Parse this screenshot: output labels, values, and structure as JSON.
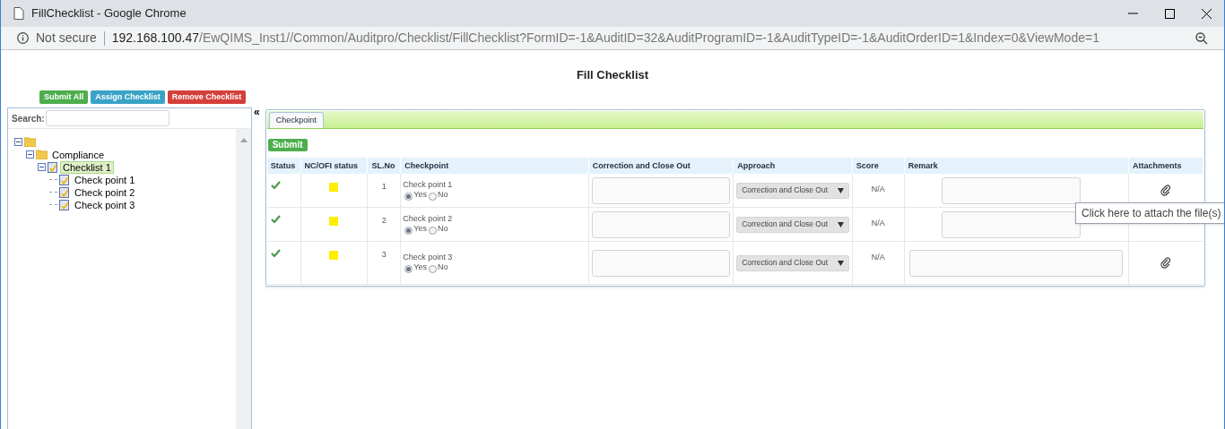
{
  "window": {
    "title": "FillChecklist - Google Chrome"
  },
  "address_bar": {
    "security": "Not secure",
    "host": "192.168.100.47",
    "path": "/EwQIMS_Inst1//Common/Auditpro/Checklist/FillChecklist?FormID=-1&AuditID=32&AuditProgramID=-1&AuditTypeID=-1&AuditOrderID=1&Index=0&ViewMode=1"
  },
  "page_title": "Fill Checklist",
  "actions": [
    {
      "label": "Submit All",
      "kind": "success"
    },
    {
      "label": "Assign Checklist",
      "kind": "info"
    },
    {
      "label": "Remove Checklist",
      "kind": "danger"
    }
  ],
  "sidebar": {
    "search_label": "Search:",
    "collapse": "«",
    "tree": [
      {
        "kind": "folder",
        "expanded": true,
        "children": [
          {
            "label": "Compliance",
            "kind": "folder",
            "expanded": true,
            "selected": false,
            "children": [
              {
                "label": "Checklist 1",
                "kind": "checklist",
                "expanded": true,
                "selected": true,
                "children": [
                  {
                    "label": "Check point 1",
                    "kind": "checklist",
                    "selected": false
                  },
                  {
                    "label": "Check point 2",
                    "kind": "checklist",
                    "selected": false
                  },
                  {
                    "label": "Check point 3",
                    "kind": "checklist",
                    "selected": false
                  }
                ]
              }
            ]
          }
        ]
      }
    ]
  },
  "tabs": [
    {
      "label": "Checkpoint",
      "selected": true
    }
  ],
  "submit": "Submit",
  "table": {
    "columns": [
      "Status",
      "NC/OFI status",
      "SL.No",
      "Checkpoint",
      "Correction and Close Out",
      "Approach",
      "Score",
      "Remark",
      "Attachments"
    ],
    "rows": [
      {
        "done": true,
        "color": "#ffee00",
        "sl": "1",
        "checkpoint": "Check point 1",
        "options": [
          {
            "label": "Yes",
            "selected": true
          },
          {
            "label": "No",
            "selected": false
          }
        ],
        "approach": "Correction and Close Out",
        "score": "N/A",
        "attachment": true
      },
      {
        "done": true,
        "color": "#ffee00",
        "sl": "2",
        "checkpoint": "Check point 2",
        "options": [
          {
            "label": "Yes",
            "selected": true
          },
          {
            "label": "No",
            "selected": false
          }
        ],
        "approach": "Correction and Close Out",
        "score": "N/A",
        "attachment": false
      },
      {
        "done": true,
        "color": "#ffee00",
        "sl": "3",
        "checkpoint": "Check point 3",
        "options": [
          {
            "label": "Yes",
            "selected": true
          },
          {
            "label": "No",
            "selected": false
          }
        ],
        "approach": "Correction and Close Out",
        "score": "N/A",
        "attachment": true
      }
    ]
  },
  "tooltip": "Click here to attach the file(s)"
}
